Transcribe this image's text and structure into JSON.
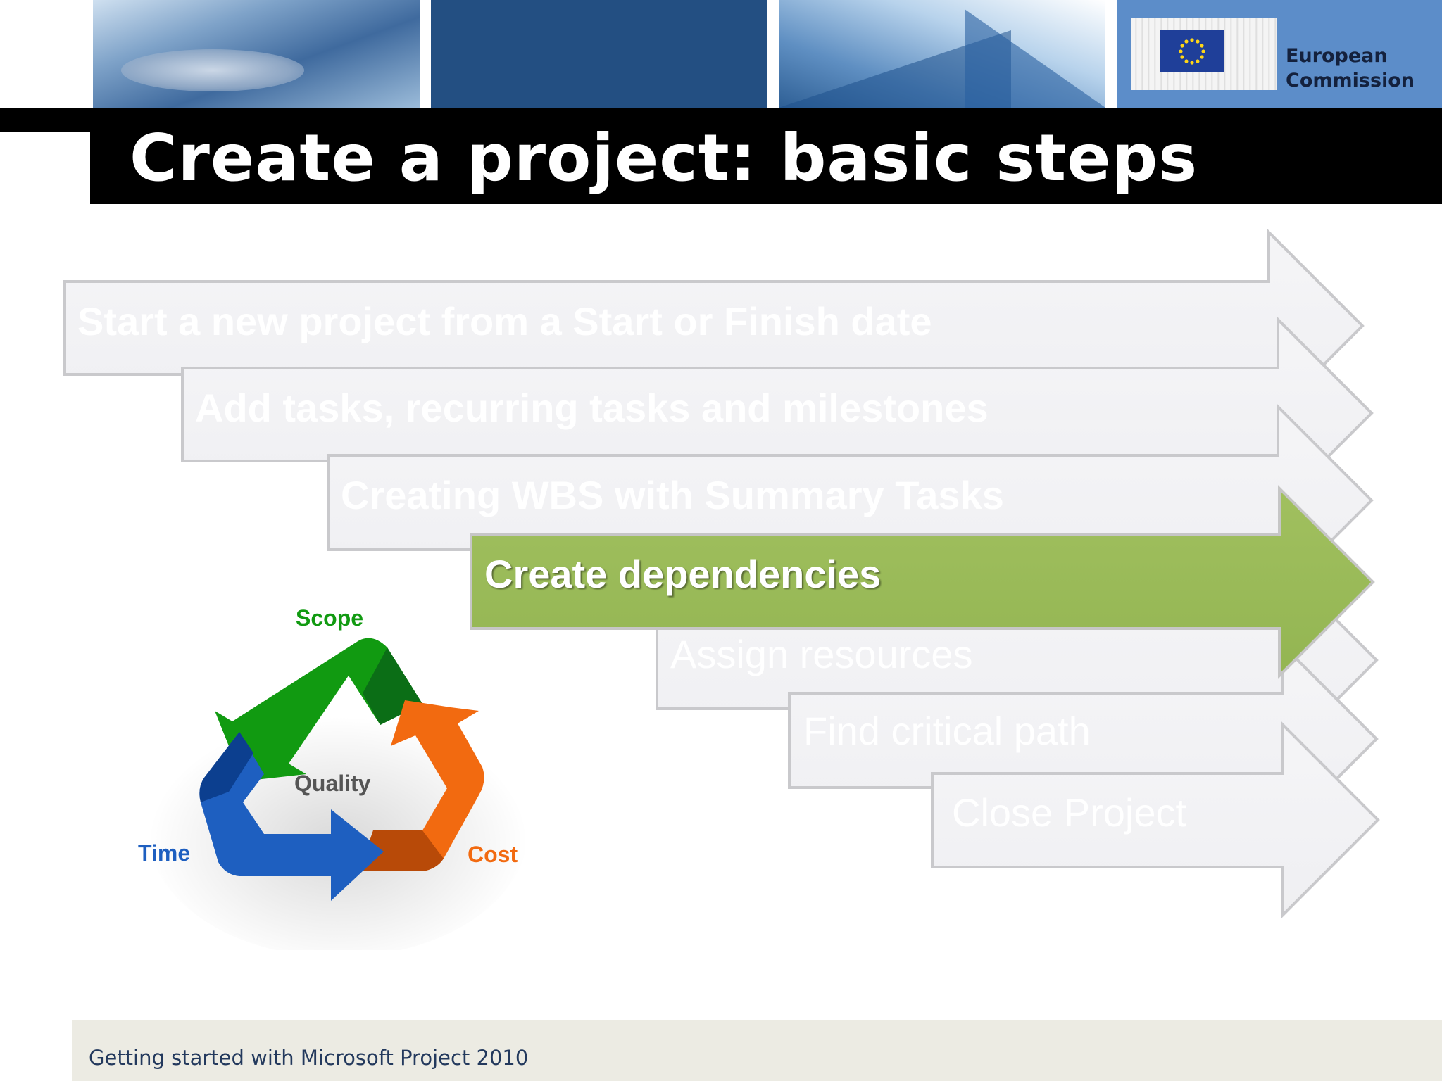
{
  "header": {
    "logo_text_line1": "European",
    "logo_text_line2": "Commission"
  },
  "slide": {
    "title": "Create a project: basic steps"
  },
  "steps": [
    {
      "label": "Start a new project from a Start or Finish date",
      "state": "inactive"
    },
    {
      "label": "Add tasks, recurring tasks and milestones",
      "state": "inactive"
    },
    {
      "label": "Creating WBS with Summary Tasks",
      "state": "inactive"
    },
    {
      "label": "Create dependencies",
      "state": "active"
    },
    {
      "label": "Assign resources",
      "state": "inactive"
    },
    {
      "label": "Find critical path",
      "state": "inactive"
    },
    {
      "label": "Close Project",
      "state": "inactive"
    }
  ],
  "triangle": {
    "top": "Scope",
    "center": "Quality",
    "left": "Time",
    "right": "Cost"
  },
  "footer": {
    "text": "Getting started with Microsoft Project 2010"
  },
  "colors": {
    "active_step": "#9bbb59",
    "inactive_step": "#f2f2f4",
    "scope": "#119a11",
    "time": "#1e5fc0",
    "cost": "#f26a10",
    "quality": "#555555"
  }
}
